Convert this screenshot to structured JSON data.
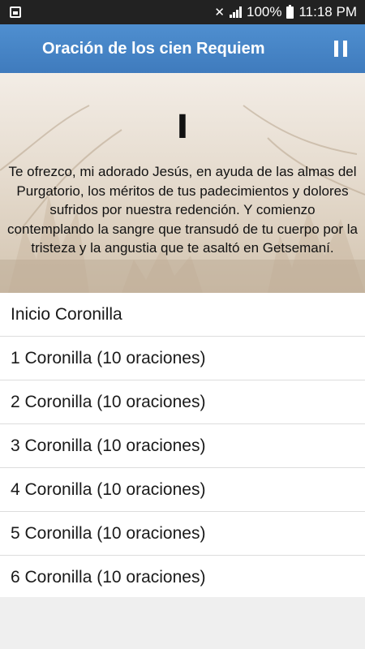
{
  "status_bar": {
    "battery_text": "100%",
    "time": "11:18 PM"
  },
  "app_bar": {
    "title": "Oración de los cien Requiem"
  },
  "hero": {
    "numeral": "I",
    "text": "Te ofrezco, mi adorado Jesús, en ayuda de las almas del Purgatorio, los méritos de tus padecimientos y dolores sufridos por nuestra redención. Y comienzo contemplando la sangre que transudó de tu cuerpo por la tristeza y la angustia que te asaltó en Getsemaní."
  },
  "list": {
    "items": [
      {
        "label": "Inicio Coronilla"
      },
      {
        "label": "1 Coronilla (10 oraciones)"
      },
      {
        "label": "2 Coronilla (10 oraciones)"
      },
      {
        "label": "3 Coronilla (10 oraciones)"
      },
      {
        "label": "4 Coronilla (10 oraciones)"
      },
      {
        "label": "5 Coronilla (10 oraciones)"
      },
      {
        "label": "6 Coronilla (10 oraciones)"
      }
    ]
  },
  "colors": {
    "app_bar": "#4a88c8",
    "status_bar": "#222222",
    "background": "#efefef"
  }
}
